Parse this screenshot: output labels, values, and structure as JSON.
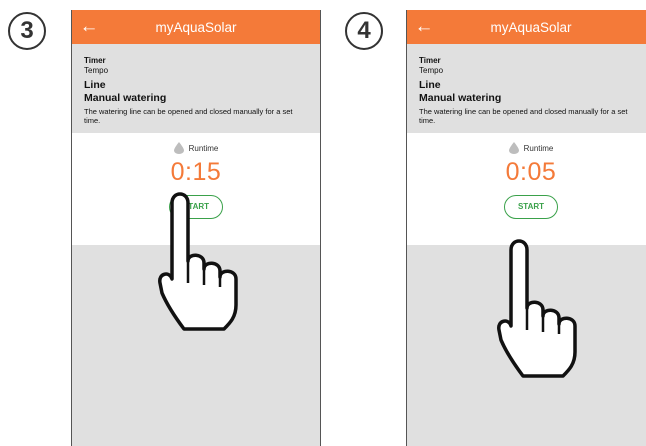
{
  "steps": [
    {
      "badge": "3",
      "app_title": "myAquaSolar",
      "back_glyph": "←",
      "timer_label": "Timer",
      "timer_sub": "Tempo",
      "line_label": "Line",
      "mode_label": "Manual watering",
      "description": "The watering line can be opened and closed manually for a set time.",
      "runtime_label": "Runtime",
      "time_value": "0:15",
      "start_label": "START"
    },
    {
      "badge": "4",
      "app_title": "myAquaSolar",
      "back_glyph": "←",
      "timer_label": "Timer",
      "timer_sub": "Tempo",
      "line_label": "Line",
      "mode_label": "Manual watering",
      "description": "The watering line can be opened and closed manually for a set time.",
      "runtime_label": "Runtime",
      "time_value": "0:05",
      "start_label": "START"
    }
  ],
  "colors": {
    "appbar": "#f47a39",
    "accent_timer": "#f47a39",
    "start_green": "#3aa14a",
    "background_gray": "#e0e0e0"
  },
  "icons": {
    "back": "arrow-left-icon",
    "runtime": "water-drop-icon",
    "pointer": "pointing-hand-icon"
  }
}
